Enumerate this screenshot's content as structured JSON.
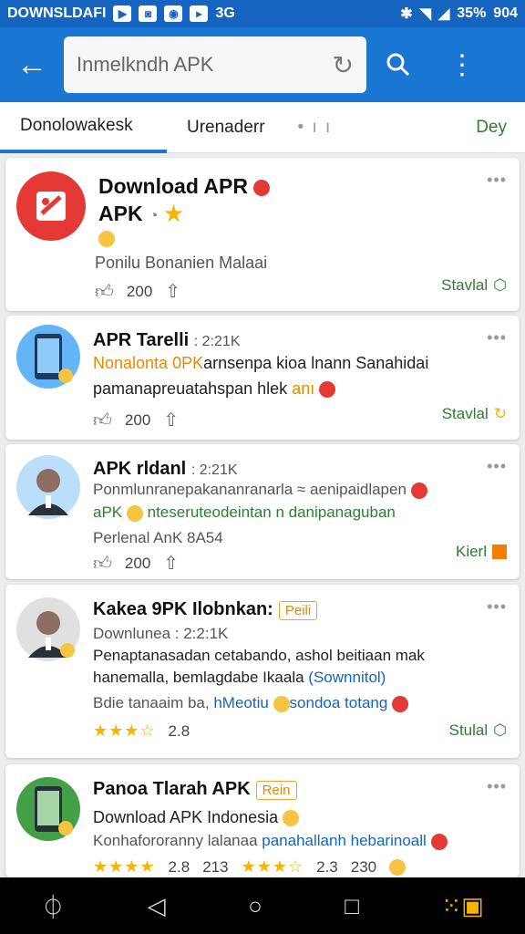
{
  "status_bar": {
    "left_text": "DOWNSLDAFI",
    "right_text": "35%",
    "time": "904",
    "signal_text": "3G"
  },
  "app_bar": {
    "search_text": "Inmelkndh APK"
  },
  "tabs": [
    {
      "label": "Donolowakesk"
    },
    {
      "label": "Urenaderr"
    },
    {
      "label": "• ı ı"
    },
    {
      "label": "Dey"
    }
  ],
  "cards": [
    {
      "title_line1": "Download APR",
      "title_line2": "APK",
      "subtitle": "Ponilu Bonanien Malaai",
      "likes": "200",
      "action": "Stavlal"
    },
    {
      "title": "APR Tarelli",
      "title_meta": "2:21K",
      "line1_a": "Nonalonta",
      "line1_b": "0PK",
      "line1_c": "arnsenpa kioa lnann Sanahidai",
      "line2_a": "pamanapreuatahspan hlek",
      "line2_b": "anı",
      "likes": "200",
      "action": "Stavlal"
    },
    {
      "title": "APK rldanl",
      "title_meta": "2:21K",
      "line1": "Ponmlunranepakananranarla ≈ aenipaidlapen",
      "line2_a": "aPK",
      "line2_b": "nteseruteodeintan n danipanaguban",
      "line3": "Perlenal AnK 8A54",
      "likes": "200",
      "action": "Kierl"
    },
    {
      "title": "Kakea 9PK Ilobnkan:",
      "badge": "Peili",
      "meta": "Downlunea : 2:2:1K",
      "line1": "Penaptanasadan cetabando, ashol beitiaan mak",
      "line2_a": "hanemalla, bemlagdabe Ikaala",
      "line2_b": "(Sownnitol)",
      "line3_a": "Bdie tanaaim ba,",
      "line3_b": "hMeotiu",
      "line3_c": "sondoa totang",
      "rating": "2.8",
      "action": "Stulal"
    },
    {
      "title": "Panoa Tlarah APK",
      "badge": "Rein",
      "line1": "Download APK Indonesia",
      "line2_a": "Konhafororanny lalanaa ",
      "line2_b": "panahallanh hebarinoall",
      "rating1": "2.8",
      "count1": "213",
      "rating2": "2.3",
      "count2": "230"
    }
  ]
}
